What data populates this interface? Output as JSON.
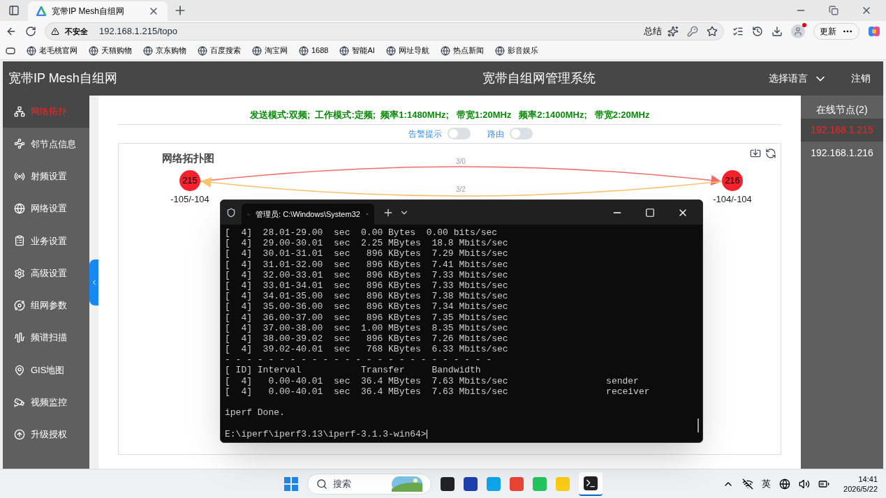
{
  "browser": {
    "tabs": [
      {
        "title": "宽带IP Mesh自组网",
        "selected": true
      }
    ],
    "address": {
      "security": "不安全",
      "url": "192.168.1.215/topo"
    },
    "summary": "总结",
    "update": "更新",
    "bookmarks": [
      "老毛桃官网",
      "天猫购物",
      "京东购物",
      "百度搜索",
      "淘宝网",
      "1688",
      "智能AI",
      "网址导航",
      "热点新闻",
      "影音娱乐"
    ]
  },
  "app": {
    "brand": "宽带IP Mesh自组网",
    "title": "宽带自组网管理系统",
    "language": "选择语言",
    "logout": "注销",
    "nav": [
      {
        "label": "网络拓扑",
        "selected": true
      },
      {
        "label": "邻节点信息",
        "selected": false
      },
      {
        "label": "射频设置",
        "selected": false
      },
      {
        "label": "网络设置",
        "selected": false
      },
      {
        "label": "业务设置",
        "selected": false
      },
      {
        "label": "高级设置",
        "selected": false
      },
      {
        "label": "组网参数",
        "selected": false
      },
      {
        "label": "频谱扫描",
        "selected": false
      },
      {
        "label": "GIS地图",
        "selected": false
      },
      {
        "label": "视频监控",
        "selected": false
      },
      {
        "label": "升级授权",
        "selected": false
      }
    ],
    "status": "发送模式:双频;  工作模式:定频;  频率1:1480MHz;   带宽1:20MHz   频率2:1400MHz;   带宽2:20MHz",
    "toggles": [
      {
        "label": "告警提示",
        "on": false
      },
      {
        "label": "路由",
        "on": false
      }
    ],
    "topology": {
      "title": "网络拓扑图",
      "nodes": [
        {
          "label": "215",
          "reading": "-105/-104"
        },
        {
          "label": "216",
          "reading": "-104/-104"
        }
      ],
      "links": [
        {
          "label": "3/0",
          "color": "#f26b6b"
        },
        {
          "label": "3/2",
          "color": "#f7c46c"
        }
      ]
    },
    "online": {
      "title": "在线节点(2)",
      "items": [
        {
          "ip": "192.168.1.215",
          "selected": true
        },
        {
          "ip": "192.168.1.216",
          "selected": false
        }
      ]
    }
  },
  "terminal": {
    "tab_title": "管理员: C:\\Windows\\System32",
    "output": [
      "[  4]  28.01-29.00  sec  0.00 Bytes  0.00 bits/sec",
      "[  4]  29.00-30.01  sec  2.25 MBytes  18.8 Mbits/sec",
      "[  4]  30.01-31.01  sec   896 KBytes  7.29 Mbits/sec",
      "[  4]  31.01-32.00  sec   896 KBytes  7.41 Mbits/sec",
      "[  4]  32.00-33.01  sec   896 KBytes  7.33 Mbits/sec",
      "[  4]  33.01-34.01  sec   896 KBytes  7.33 Mbits/sec",
      "[  4]  34.01-35.00  sec   896 KBytes  7.38 Mbits/sec",
      "[  4]  35.00-36.00  sec   896 KBytes  7.34 Mbits/sec",
      "[  4]  36.00-37.00  sec   896 KBytes  7.35 Mbits/sec",
      "[  4]  37.00-38.00  sec  1.00 MBytes  8.35 Mbits/sec",
      "[  4]  38.00-39.02  sec   896 KBytes  7.26 Mbits/sec",
      "[  4]  39.02-40.01  sec   768 KBytes  6.33 Mbits/sec",
      "- - - - - - - - - - - - - - - - - - - - - - - - -",
      "[ ID] Interval           Transfer     Bandwidth",
      "[  4]   0.00-40.01  sec  36.4 MBytes  7.63 Mbits/sec                  sender",
      "[  4]   0.00-40.01  sec  36.4 MBytes  7.63 Mbits/sec                  receiver"
    ],
    "done": "iperf Done.",
    "prompt": "E:\\iperf\\iperf3.13\\iperf-3.1.3-win64>"
  },
  "taskbar": {
    "search": "搜索",
    "ime": "英",
    "time": "14:41",
    "date": "2026/5/22"
  }
}
